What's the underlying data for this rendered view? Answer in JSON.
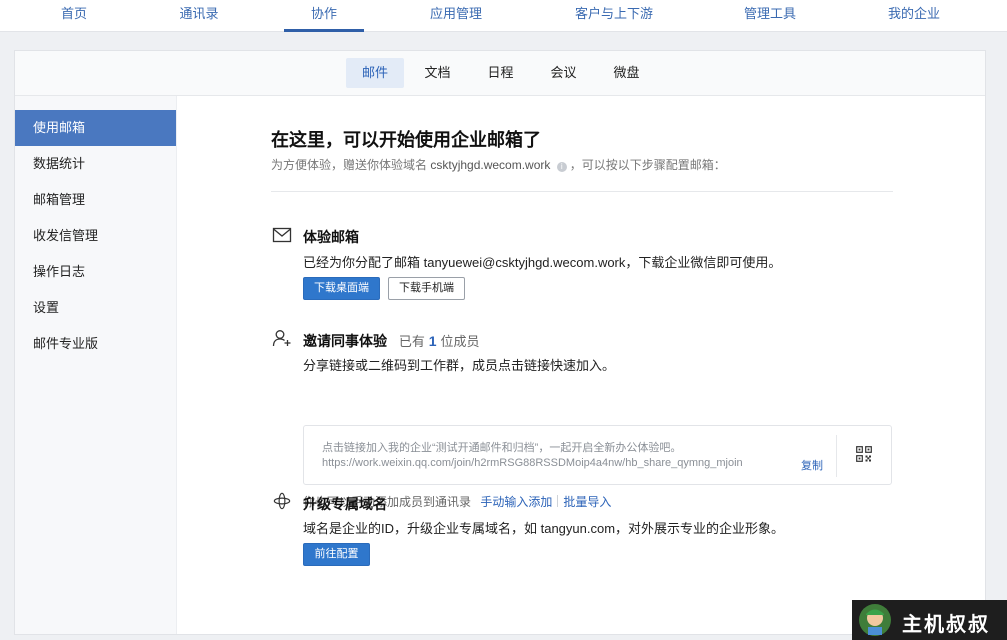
{
  "topnav": {
    "items": [
      {
        "label": "首页"
      },
      {
        "label": "通讯录"
      },
      {
        "label": "协作"
      },
      {
        "label": "应用管理"
      },
      {
        "label": "客户与上下游"
      },
      {
        "label": "管理工具"
      },
      {
        "label": "我的企业"
      }
    ],
    "active": "协作"
  },
  "subtabs": {
    "items": [
      {
        "label": "邮件"
      },
      {
        "label": "文档"
      },
      {
        "label": "日程"
      },
      {
        "label": "会议"
      },
      {
        "label": "微盘"
      }
    ],
    "active": "邮件"
  },
  "sidebar": {
    "items": [
      {
        "label": "使用邮箱"
      },
      {
        "label": "数据统计"
      },
      {
        "label": "邮箱管理"
      },
      {
        "label": "收发信管理"
      },
      {
        "label": "操作日志"
      },
      {
        "label": "设置"
      },
      {
        "label": "邮件专业版"
      }
    ],
    "active": "使用邮箱"
  },
  "hero": {
    "title": "在这里，可以开始使用企业邮箱了",
    "sub_prefix": "为方便体验，赠送你体验域名",
    "domain": "csktyjhgd.wecom.work",
    "sub_suffix": "，可以按以下步骤配置邮箱："
  },
  "trial_mailbox": {
    "icon": "mail-icon",
    "title": "体验邮箱",
    "desc": "已经为你分配了邮箱 tanyuewei@csktyjhgd.wecom.work，下载企业微信即可使用。",
    "download_desktop_label": "下载桌面端",
    "download_mobile_label": "下载手机端"
  },
  "invite": {
    "icon": "add-user-icon",
    "title": "邀请同事体验",
    "count_prefix": "已有",
    "count": "1",
    "count_suffix": "位成员",
    "desc": "分享链接或二维码到工作群，成员点击链接快速加入。",
    "share_text": "点击链接加入我的企业“测试开通邮件和归档”，一起开启全新办公体验吧。",
    "share_url": "https://work.weixin.qq.com/join/h2rmRSG88RSSDMoip4a4nw/hb_share_qymng_mjoin",
    "copy_label": "复制",
    "qr_icon": "qrcode-icon",
    "manual_prefix": "你也可以手动添加成员到通讯录",
    "manual_add_label": "手动输入添加",
    "batch_import_label": "批量导入"
  },
  "upgrade_domain": {
    "icon": "domain-icon",
    "title": "升级专属域名",
    "desc": "域名是企业的ID，升级企业专属域名，如 tangyun.com，对外展示专业的企业形象。",
    "go_config_label": "前往配置"
  },
  "colors": {
    "accent": "#2f77cc",
    "sidebar_active": "#4a78c0",
    "nav_text": "#3a6ab1"
  }
}
